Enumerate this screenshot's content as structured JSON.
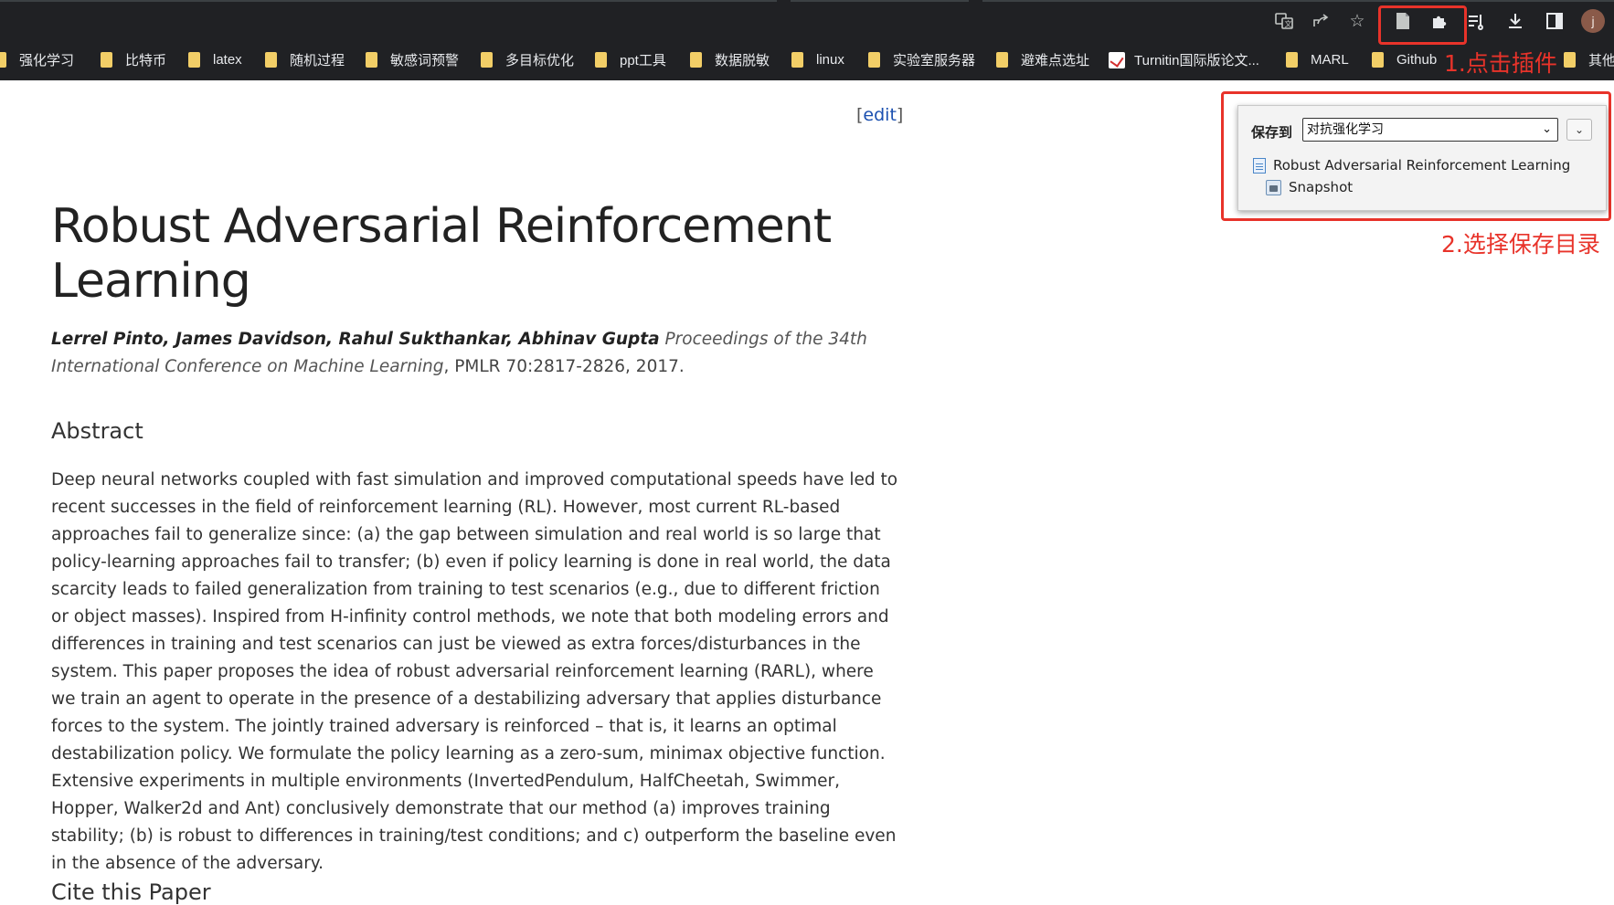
{
  "browser": {
    "toolbar_icons": [
      "translate-icon",
      "share-icon",
      "star-icon",
      "zotero-save-icon",
      "extensions-icon",
      "reading-list-icon",
      "download-icon",
      "side-panel-icon"
    ],
    "avatar_letter": "j"
  },
  "bookmarks": [
    {
      "label": "强化学习",
      "icon": "folder-icon"
    },
    {
      "label": "比特币",
      "icon": "folder-icon"
    },
    {
      "label": "latex",
      "icon": "folder-icon"
    },
    {
      "label": "随机过程",
      "icon": "folder-icon"
    },
    {
      "label": "敏感词预警",
      "icon": "folder-icon"
    },
    {
      "label": "多目标优化",
      "icon": "folder-icon"
    },
    {
      "label": "ppt工具",
      "icon": "folder-icon"
    },
    {
      "label": "数据脱敏",
      "icon": "folder-icon"
    },
    {
      "label": "linux",
      "icon": "folder-icon"
    },
    {
      "label": "实验室服务器",
      "icon": "folder-icon"
    },
    {
      "label": "避难点选址",
      "icon": "folder-icon"
    },
    {
      "label": "Turnitin国际版论文...",
      "icon": "turnitin-icon"
    },
    {
      "label": "MARL",
      "icon": "folder-icon"
    },
    {
      "label": "Github",
      "icon": "folder-icon"
    },
    {
      "label": "其他",
      "icon": "folder-icon"
    }
  ],
  "annotations": {
    "step1": "1.点击插件",
    "step2": "2.选择保存目录",
    "color": "#e8332a"
  },
  "zotero_popup": {
    "save_to_label": "保存到",
    "selected_collection": "对抗强化学习",
    "item_title": "Robust Adversarial Reinforcement Learning",
    "attachment_label": "Snapshot"
  },
  "page": {
    "edit_link": "edit",
    "title": "Robust Adversarial Reinforcement Learning",
    "authors": "Lerrel Pinto, James Davidson, Rahul Sukthankar, Abhinav Gupta",
    "venue": "Proceedings of the 34th International Conference on Machine Learning",
    "citation_tail": ", PMLR 70:2817-2826, 2017.",
    "abstract_heading": "Abstract",
    "abstract": "Deep neural networks coupled with fast simulation and improved computational speeds have led to recent successes in the field of reinforcement learning (RL). However, most current RL-based approaches fail to generalize since: (a) the gap between simulation and real world is so large that policy-learning approaches fail to transfer; (b) even if policy learning is done in real world, the data scarcity leads to failed generalization from training to test scenarios (e.g., due to different friction or object masses). Inspired from H-infinity control methods, we note that both modeling errors and differences in training and test scenarios can just be viewed as extra forces/disturbances in the system. This paper proposes the idea of robust adversarial reinforcement learning (RARL), where we train an agent to operate in the presence of a destabilizing adversary that applies disturbance forces to the system. The jointly trained adversary is reinforced – that is, it learns an optimal destabilization policy. We formulate the policy learning as a zero-sum, minimax objective function. Extensive experiments in multiple environments (InvertedPendulum, HalfCheetah, Swimmer, Hopper, Walker2d and Ant) conclusively demonstrate that our method (a) improves training stability; (b) is robust to differences in training/test conditions; and c) outperform the baseline even in the absence of the adversary.",
    "cite_heading": "Cite this Paper"
  }
}
